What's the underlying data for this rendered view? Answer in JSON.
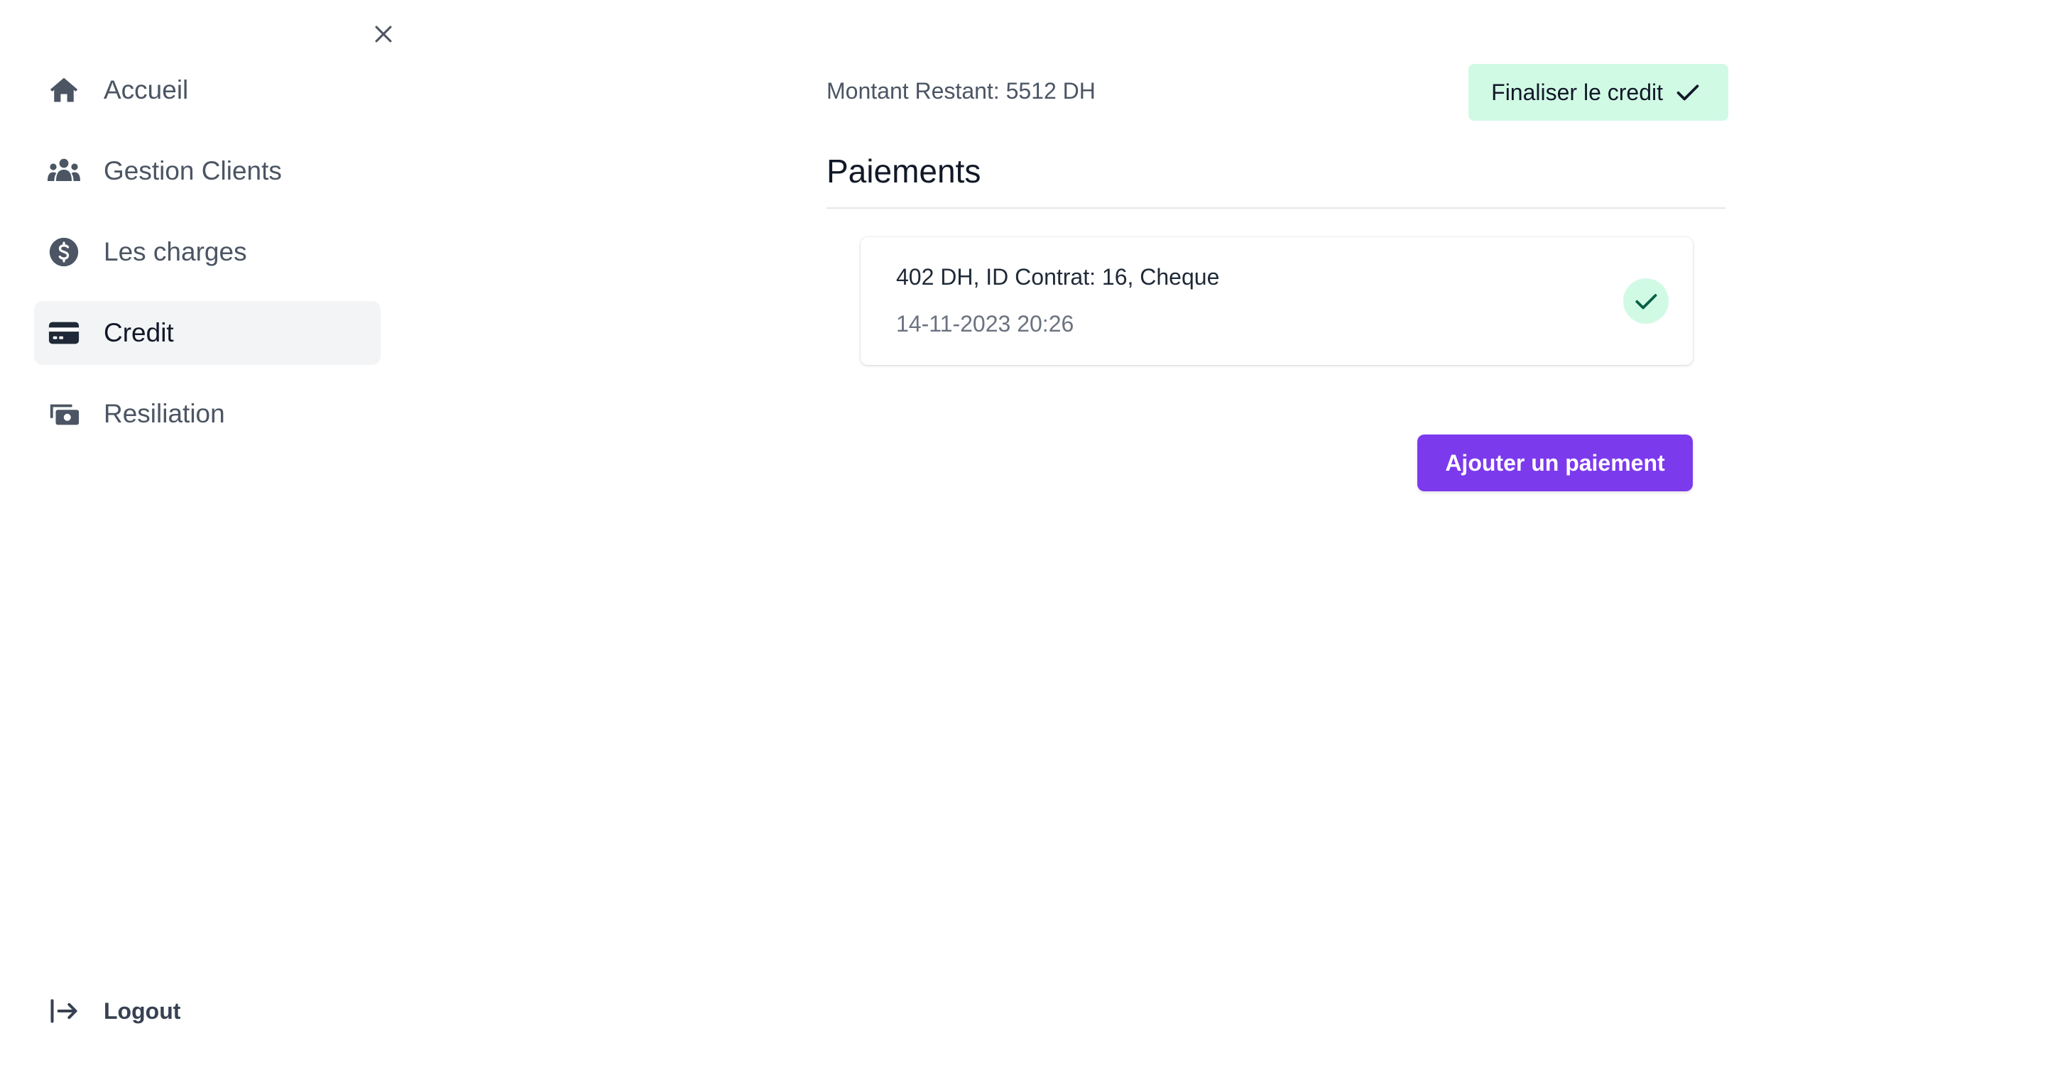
{
  "sidebar": {
    "items": [
      {
        "label": "Accueil",
        "icon": "home-icon"
      },
      {
        "label": "Gestion Clients",
        "icon": "users-icon"
      },
      {
        "label": "Les charges",
        "icon": "dollar-circle-icon"
      },
      {
        "label": "Credit",
        "icon": "credit-card-icon",
        "active": true
      },
      {
        "label": "Resiliation",
        "icon": "cash-icon"
      }
    ],
    "logout_label": "Logout"
  },
  "main": {
    "remaining_text": "Montant Restant: 5512 DH",
    "finalize_label": "Finaliser le credit",
    "section_title": "Paiements",
    "payments": [
      {
        "summary": "402 DH, ID Contrat: 16, Cheque",
        "date": "14-11-2023 20:26",
        "status": "validated"
      }
    ],
    "add_payment_label": "Ajouter un paiement"
  },
  "colors": {
    "accent": "#7c3aed",
    "success_bg": "#d1fae5",
    "success_fg": "#065f46",
    "active_nav_bg": "#f3f4f6"
  }
}
